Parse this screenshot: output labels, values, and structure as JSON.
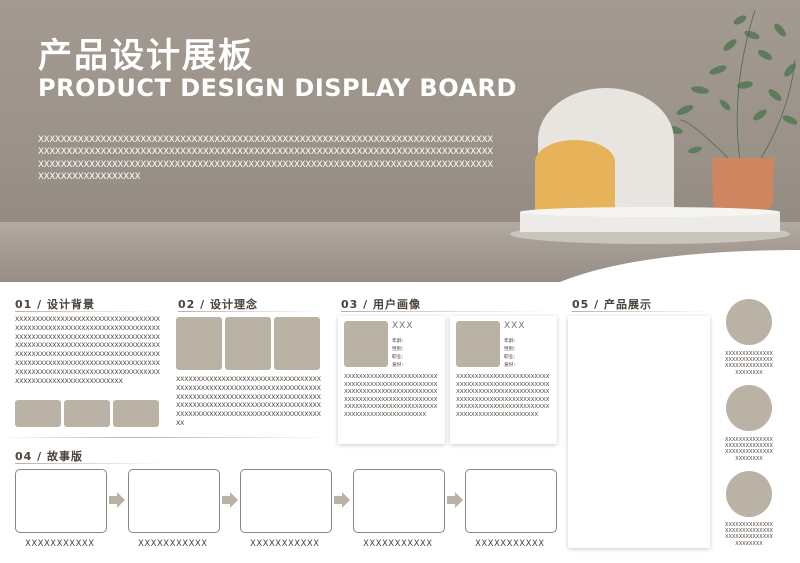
{
  "header": {
    "title_cn": "产品设计展板",
    "title_en": "PRODUCT DESIGN DISPLAY BOARD",
    "intro": "XXXXXXXXXXXXXXXXXXXXXXXXXXXXXXXXXXXXXXXXXXXXXXXXXXXXXXXXXXXXXXXXXXXXXXXXXXXXXXXXXXXXXXXXXXXXXXXXXXXXXXXXXXXXXXXXXXXXXXXXXXXXXXXXXXXXXXXXXXXXXXXXXXXXXXXXXXXXXXXXXXXXXXXXXXXXXXXXXXXXXXXXXXXXXXXXXXXXXXXXXXXXXXXXXXXXXXXXXXXXXXXXXXXXXXXXXXXXXXXXXXXXXXXXXXXXXXXXXX"
  },
  "sections": {
    "s1": {
      "title": "01 / 设计背景",
      "text": "XXXXXXXXXXXXXXXXXXXXXXXXXXXXXXXXXXXXXXXXXXXXXXXXXXXXXXXXXXXXXXXXXXXXXXXXXXXXXXXXXXXXXXXXXXXXXXXXXXXXXXXXXXXXXXXXXXXXXXXXXXXXXXXXXXXXXXXXXXXXXXXXXXXXXXXXXXXXXXXXXXXXXXXXXXXXXXXXXXXXXXXXXXXXXXXXXXXXXXXXXXXXXXXXXXXXXXXXXXXXXXXXXXXXXXXXXXXXXXXXXXXXXXXXXXXXXXXXXXXXXXXXXXXXXXX"
    },
    "s2": {
      "title": "02 / 设计理念",
      "text": "XXXXXXXXXXXXXXXXXXXXXXXXXXXXXXXXXXXXXXXXXXXXXXXXXXXXXXXXXXXXXXXXXXXXXXXXXXXXXXXXXXXXXXXXXXXXXXXXXXXXXXXXXXXXXXXXXXXXXXXXXXXXXXXXXXXXXXXXXXXXXXXXXXXXXXXXXXXXXXXXXXXXXXXXXXXXXXXXX"
    },
    "s3": {
      "title": "03 / 用户画像",
      "cards": [
        {
          "name": "XXX",
          "fields": [
            "年龄:",
            "性别:",
            "职业:",
            "爱好:"
          ],
          "text": "XXXXXXXXXXXXXXXXXXXXXXXXXXXXXXXXXXXXXXXXXXXXXXXXXXXXXXXXXXXXXXXXXXXXXXXXXXXXXXXXXXXXXXXXXXXXXXXXXXXXXXXXXXXXXXXXXXXXXXXXXXXXXXXXXXXXXXXXXXXXXXXXXXX"
        },
        {
          "name": "XXX",
          "fields": [
            "年龄:",
            "性别:",
            "职业:",
            "爱好:"
          ],
          "text": "XXXXXXXXXXXXXXXXXXXXXXXXXXXXXXXXXXXXXXXXXXXXXXXXXXXXXXXXXXXXXXXXXXXXXXXXXXXXXXXXXXXXXXXXXXXXXXXXXXXXXXXXXXXXXXXXXXXXXXXXXXXXXXXXXXXXXXXXXXXXXXXXXXX"
        }
      ]
    },
    "s4": {
      "title": "04 / 故事版",
      "labels": [
        "XXXXXXXXXXX",
        "XXXXXXXXXXX",
        "XXXXXXXXXXX",
        "XXXXXXXXXXX",
        "XXXXXXXXXXX"
      ]
    },
    "s5": {
      "title": "05 / 产品展示",
      "captions": [
        "XXXXXXXXXXXXXXXXXXXXXXXXXXXXXXXXXXXXXXXXXXXXXXXXXX",
        "XXXXXXXXXXXXXXXXXXXXXXXXXXXXXXXXXXXXXXXXXXXXXXXXXX",
        "XXXXXXXXXXXXXXXXXXXXXXXXXXXXXXXXXXXXXXXXXXXXXXXXXX"
      ]
    }
  },
  "colors": {
    "accent_tan": "#bab2a4",
    "hero_bg": "#9a9288",
    "text_dark": "#4a423b"
  }
}
